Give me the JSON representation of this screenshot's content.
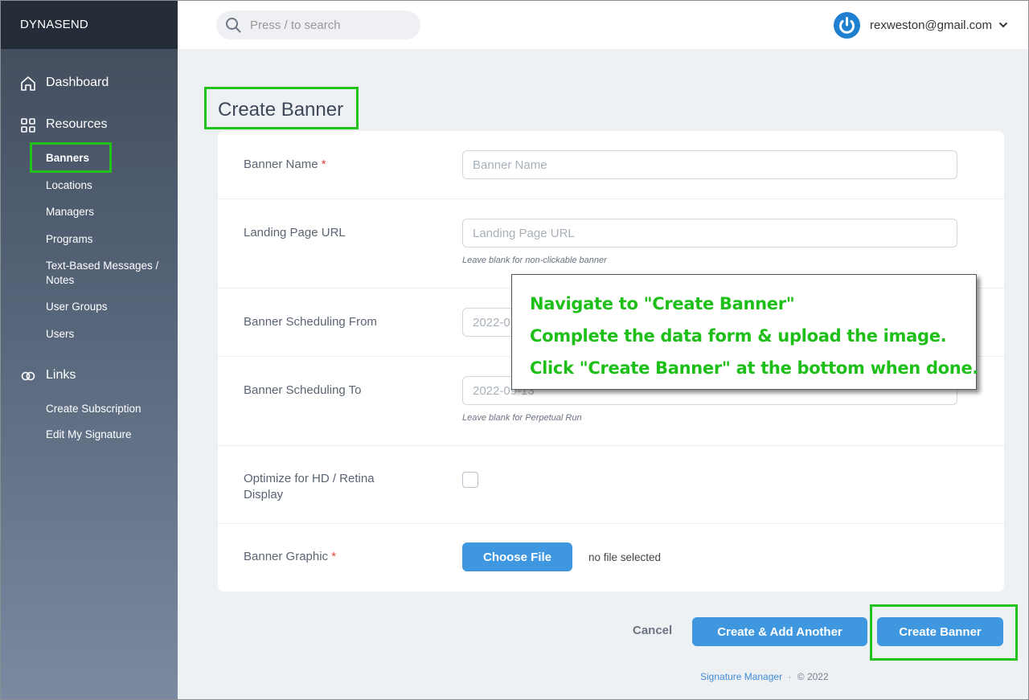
{
  "app": {
    "brand": "DYNASEND"
  },
  "search": {
    "placeholder": "Press / to search"
  },
  "user": {
    "email": "rexweston@gmail.com"
  },
  "sidebar": {
    "dashboard": "Dashboard",
    "resources": "Resources",
    "resource_items": [
      "Banners",
      "Locations",
      "Managers",
      "Programs",
      "Text-Based Messages / Notes",
      "User Groups",
      "Users"
    ],
    "links": "Links",
    "link_items": [
      "Create Subscription",
      "Edit My Signature"
    ]
  },
  "page": {
    "title": "Create Banner"
  },
  "form": {
    "banner_name": {
      "label": "Banner Name",
      "required_mark": "*",
      "placeholder": "Banner Name"
    },
    "landing_url": {
      "label": "Landing Page URL",
      "placeholder": "Landing Page URL",
      "help": "Leave blank for non-clickable banner"
    },
    "schedule_from": {
      "label": "Banner Scheduling From",
      "value": "2022-0"
    },
    "schedule_to": {
      "label": "Banner Scheduling To",
      "value": "2022-09-13",
      "help": "Leave blank for Perpetual Run"
    },
    "optimize": {
      "label": "Optimize for HD / Retina Display"
    },
    "graphic": {
      "label": "Banner Graphic",
      "required_mark": "*",
      "button": "Choose File",
      "status": "no file selected"
    }
  },
  "actions": {
    "cancel": "Cancel",
    "create_add": "Create & Add Another",
    "create": "Create Banner"
  },
  "footer": {
    "link": "Signature Manager",
    "sep": "·",
    "copyright": "© 2022"
  },
  "callout": {
    "lines": [
      "Navigate to \"Create Banner\"",
      "Complete the data form & upload the image.",
      "Click \"Create Banner\" at the bottom when done."
    ]
  },
  "colors": {
    "accent": "#3f97e0",
    "highlight": "#22c21c",
    "callout_text": "#1fbf1a",
    "sidebar_top": "#252d38"
  }
}
